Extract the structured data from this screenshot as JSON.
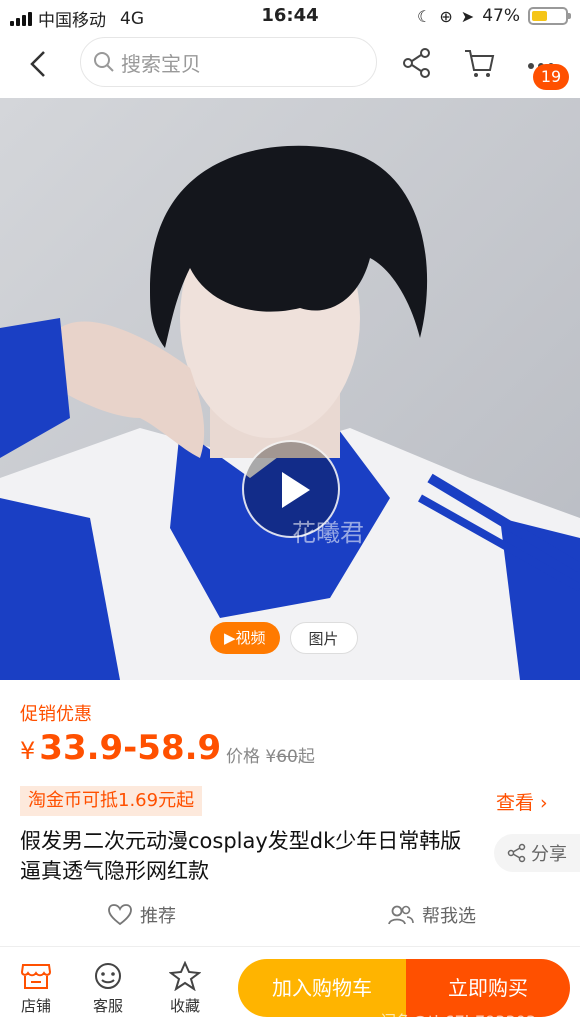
{
  "status": {
    "carrier": "中国移动",
    "network": "4G",
    "time": "16:44",
    "battery": "47%",
    "battery_level": 0.47
  },
  "nav": {
    "search_placeholder": "搜索宝贝",
    "cart_badge": "19"
  },
  "hero": {
    "watermark": "花曦君",
    "tab_video": "▶视频",
    "tab_photo": "图片"
  },
  "product": {
    "promo_label": "促销优惠",
    "price_currency": "¥",
    "price_range": "33.9-58.9",
    "orig_label": "价格 ¥",
    "orig_num": "60",
    "orig_suffix": "起",
    "coin_text": "淘金币可抵1.69元起",
    "look_more": "查看 ›",
    "title": "假发男二次元动漫cosplay发型dk少年日常韩版逼真透气隐形网红款",
    "share": "分享",
    "recommend": "推荐",
    "help_choose": "帮我选"
  },
  "bottom": {
    "shop": "店铺",
    "service": "客服",
    "favorite": "收藏",
    "add_cart": "加入购物车",
    "buy_now": "立即购买"
  },
  "watermark2": "闲鱼@tb67b793303",
  "colors": {
    "accent": "#ff5000",
    "cart": "#ffb400"
  }
}
